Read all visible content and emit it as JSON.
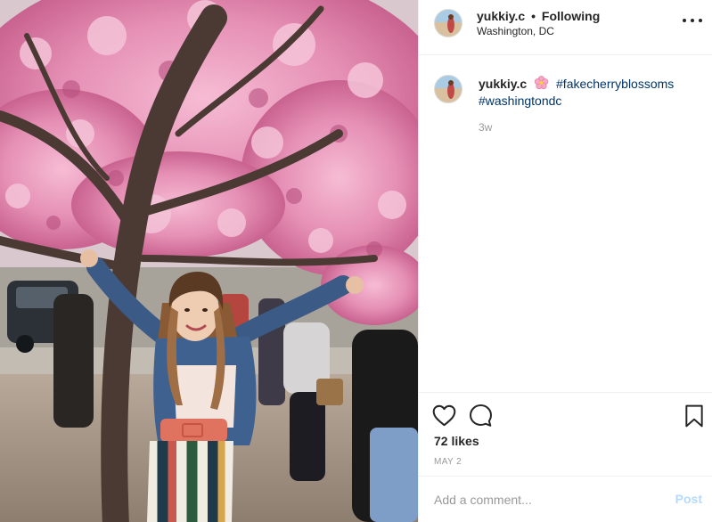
{
  "photo": {
    "alt": "",
    "icon": "post-photo"
  },
  "header": {
    "username": "yukkiy.c",
    "separator": "•",
    "follow_status": "Following",
    "location": "Washington, DC",
    "more_icon": "more-options-icon"
  },
  "caption": {
    "username": "yukkiy.c",
    "emoji": "cherry-blossom-emoji",
    "hashtags": [
      "#fakecherryblossoms",
      "#washingtondc"
    ],
    "time_ago": "3w"
  },
  "actions": {
    "like_icon": "heart-icon",
    "comment_icon": "comment-icon",
    "save_icon": "bookmark-icon",
    "likes": "72 likes",
    "date": "MAY 2"
  },
  "comment_box": {
    "placeholder": "Add a comment...",
    "post_label": "Post"
  },
  "colors": {
    "hashtag": "#003569",
    "muted": "#999999",
    "post_disabled": "#b3dbff",
    "divider": "#efefef",
    "blossom": "#e88fb2"
  }
}
